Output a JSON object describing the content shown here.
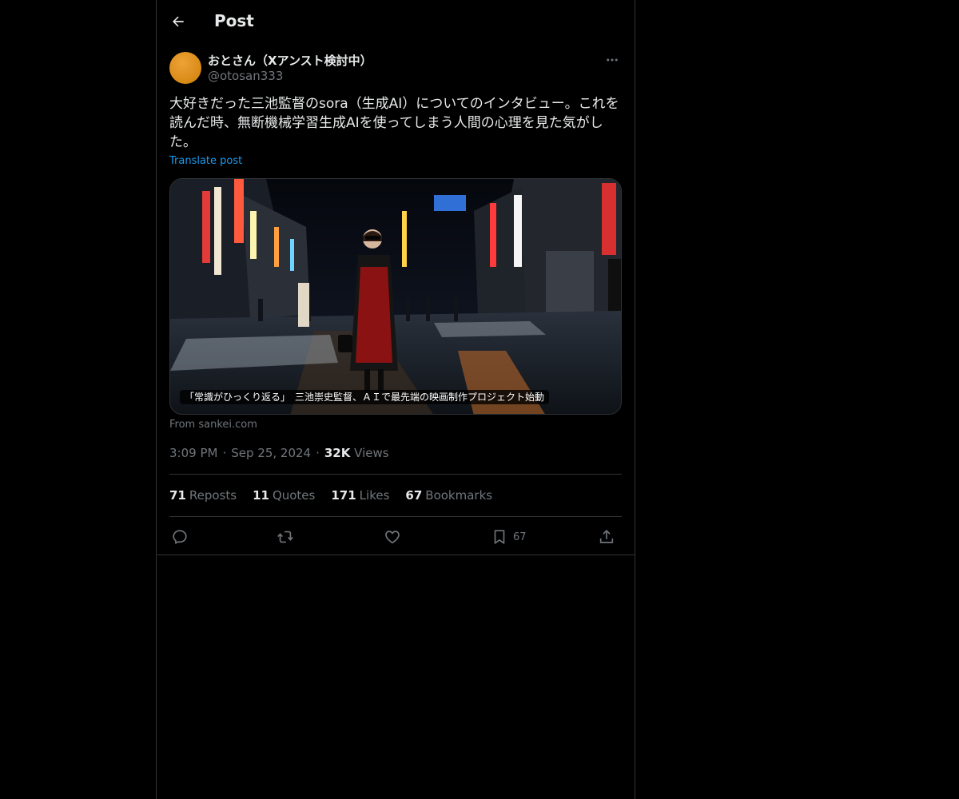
{
  "header": {
    "title": "Post",
    "back_icon": "arrow-left-icon"
  },
  "author": {
    "display_name": "おとさん（Xアンスト検討中）",
    "handle": "@otosan333",
    "avatar_color": "#e0921e"
  },
  "post": {
    "text": "大好きだった三池監督のsora（生成AI）についてのインタビュー。これを読んだ時、無断機械学習生成AIを使ってしまう人間の心理を見た気がした。",
    "translate_label": "Translate post"
  },
  "card": {
    "caption": "「常識がひっくり返る」　三池崇史監督、ＡＩで最先端の映画制作プロジェクト始動",
    "source": "From sankei.com"
  },
  "meta": {
    "time": "3:09 PM",
    "date": "Sep 25, 2024",
    "views_count": "32K",
    "views_label": "Views"
  },
  "stats": [
    {
      "num": "71",
      "label": "Reposts"
    },
    {
      "num": "11",
      "label": "Quotes"
    },
    {
      "num": "171",
      "label": "Likes"
    },
    {
      "num": "67",
      "label": "Bookmarks"
    }
  ],
  "actions": {
    "bookmark_count": "67"
  },
  "colors": {
    "background": "#000000",
    "border": "#2f3336",
    "text": "#e7e9ea",
    "muted": "#71767b",
    "link": "#1d9bf0"
  }
}
